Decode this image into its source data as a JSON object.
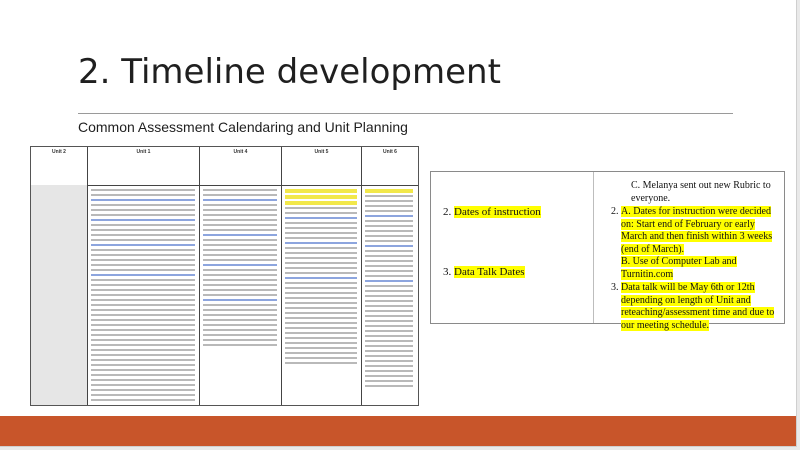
{
  "slide": {
    "title": "2. Timeline development",
    "subtitle": "Common Assessment Calendaring and Unit Planning"
  },
  "table_image": {
    "header_cells": [
      {
        "title": "Unit 2",
        "sub": "Unit 1"
      },
      {
        "title": "Unit 3",
        "sub": ""
      },
      {
        "title": "Unit 4",
        "sub": ""
      },
      {
        "title": "Unit 5",
        "sub": ""
      },
      {
        "title": "Unit 6",
        "sub": ""
      }
    ]
  },
  "notes_panel": {
    "left_items": [
      {
        "number": "2.",
        "text": "Dates of instruction"
      },
      {
        "number": "3.",
        "text": "Data Talk Dates"
      }
    ],
    "right_intro": "C. Melanya sent out new Rubric to everyone.",
    "right_items": [
      "A. Dates for instruction were decided on: Start end of February or early March and then finish within 3 weeks (end of March).",
      "B. Use of Computer Lab and Turnitin.com",
      "Data talk will be May 6th or 12th depending on length of Unit and reteaching/assessment time and due to our meeting schedule."
    ]
  },
  "colors": {
    "accent_bar": "#c8552a",
    "highlight": "#ffff00"
  }
}
